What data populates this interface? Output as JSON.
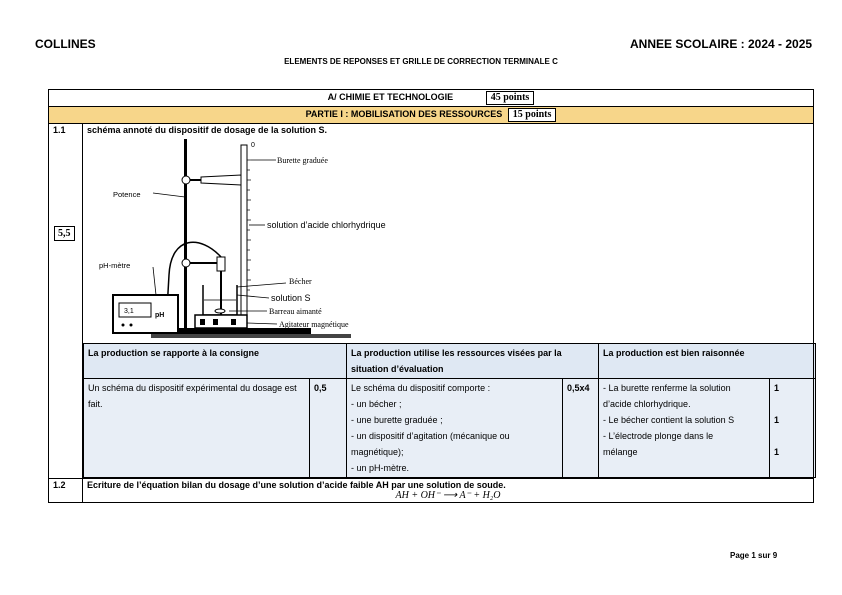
{
  "header": {
    "left": "COLLINES",
    "right": "ANNEE SCOLAIRE : 2024 - 2025",
    "subtitle": "ELEMENTS DE REPONSES ET GRILLE DE CORRECTION TERMINALE C"
  },
  "section": {
    "title": "A/ CHIMIE ET TECHNOLOGIE",
    "points": "45 points"
  },
  "part": {
    "title": "PARTIE I : MOBILISATION DES RESSOURCES",
    "points": "15 points"
  },
  "q1": {
    "num": "1.1",
    "title": "schéma annoté du dispositif de dosage de la solution S.",
    "score": "5,5",
    "labels": {
      "burette": "Burette graduée",
      "potence": "Potence",
      "acide": "solution d’acide chlorhydrique",
      "phmetre": "pH-mètre",
      "becher": "Bécher",
      "solution": "solution S",
      "barreau": "Barreau aimanté",
      "agitateur": "Agitateur magnétique",
      "display": "3,1",
      "ph": "pH",
      "zero": "0"
    },
    "criteria": {
      "c1_head": "La production se rapporte à la consigne",
      "c2_head": "La production utilise les ressources visées par la situation d’évaluation",
      "c3_head": "La production est bien raisonnée",
      "c1_text": "Un schéma du dispositif expérimental du dosage est fait.",
      "c1_pts": "0,5",
      "c2_lines": [
        "Le schéma du dispositif comporte :",
        "- un bécher ;",
        "- une burette graduée ;",
        "- un dispositif d’agitation (mécanique ou",
        "magnétique);",
        "- un pH-mètre."
      ],
      "c2_pts": "0,5x4",
      "c3_lines": [
        "- La burette renferme la solution",
        "d’acide chlorhydrique.",
        "- Le bécher contient la solution S",
        "- L’électrode plonge dans le",
        "mélange"
      ],
      "c3_pts": [
        "1",
        "1",
        "1"
      ]
    }
  },
  "q2": {
    "num": "1.2",
    "title": "Ecriture de l’équation bilan du dosage d’une solution d’acide faible AH par une solution de soude.",
    "equation": "AH + OH⁻ ⟶ A⁻ + H₂O"
  },
  "footer": "Page 1 sur 9"
}
